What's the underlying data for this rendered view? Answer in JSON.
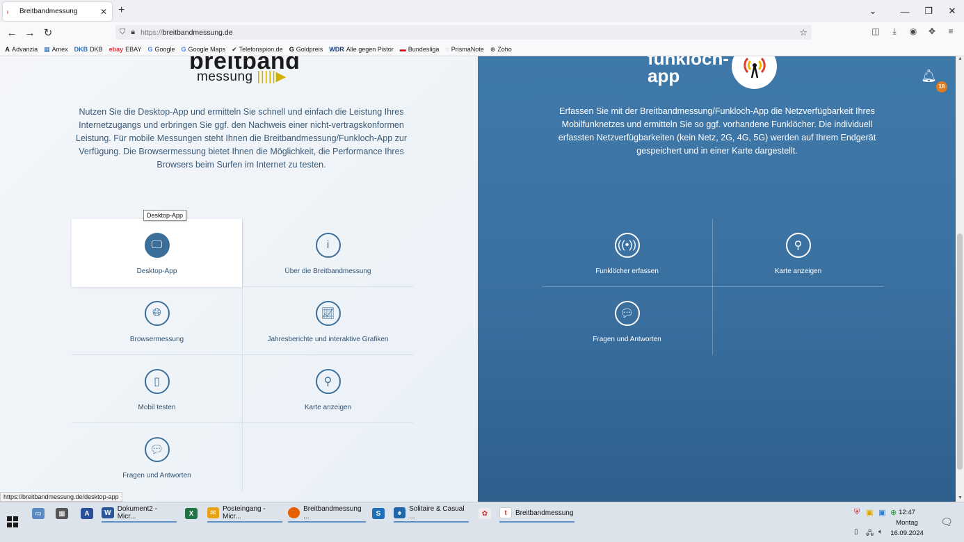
{
  "browser": {
    "tab_title": "Breitbandmessung",
    "url_protocol": "https://",
    "url_host": "breitbandmessung.de",
    "bookmarks": [
      {
        "icon": "Ꭺ",
        "label": "Advanzia",
        "color": "#222"
      },
      {
        "icon": "▦",
        "label": "Amex",
        "color": "#2a6db5"
      },
      {
        "icon": "DKB",
        "label": "DKB",
        "color": "#2a6db5"
      },
      {
        "icon": "ebay",
        "label": "EBAY",
        "color": "#e53238"
      },
      {
        "icon": "G",
        "label": "Google",
        "color": "#4285f4"
      },
      {
        "icon": "G",
        "label": "Google Maps",
        "color": "#4285f4"
      },
      {
        "icon": "✔",
        "label": "Telefonspion.de",
        "color": "#333"
      },
      {
        "icon": "G",
        "label": "Goldpreis",
        "color": "#111"
      },
      {
        "icon": "WDR",
        "label": "Alle gegen Pistor",
        "color": "#1a3c78"
      },
      {
        "icon": "▬",
        "label": "Bundesliga",
        "color": "#d20515"
      },
      {
        "icon": "◌",
        "label": "PrismaNote",
        "color": "#3a9"
      },
      {
        "icon": "⊕",
        "label": "Zoho",
        "color": "#555"
      }
    ],
    "status_url": "https://breitbandmessung.de/desktop-app"
  },
  "left": {
    "logo_line1": "breitband",
    "logo_line2": "messung",
    "description": "Nutzen Sie die Desktop-App und ermitteln Sie schnell und einfach die Leistung Ihres Internetzugangs und erbringen Sie ggf. den Nachweis einer nicht-vertragskonformen Leistung. Für mobile Messungen steht Ihnen die Breitbandmessung/Funkloch-App zur Verfügung. Die Browsermessung bietet Ihnen die Möglichkeit, die Performance Ihres Browsers beim Surfen im Internet zu testen.",
    "items": [
      {
        "label": "Desktop-App",
        "icon": "monitor-icon"
      },
      {
        "label": "Über die Breitbandmessung",
        "icon": "info-icon"
      },
      {
        "label": "Browsermessung",
        "icon": "globe-icon"
      },
      {
        "label": "Jahresberichte und interaktive Grafiken",
        "icon": "chart-icon"
      },
      {
        "label": "Mobil testen",
        "icon": "mobile-icon"
      },
      {
        "label": "Karte anzeigen",
        "icon": "map-pin-icon"
      },
      {
        "label": "Fragen und Antworten",
        "icon": "chat-icon"
      }
    ],
    "tooltip": "Desktop-App"
  },
  "right": {
    "logo_line1": "funkloch-",
    "logo_line2": "app",
    "description": "Erfassen Sie mit der Breitbandmessung/Funkloch-App die Netzverfügbarkeit Ihres Mobilfunknetzes und ermitteln Sie so ggf. vorhandene Funklöcher. Die individuell erfassten Netzverfügbarkeiten (kein Netz, 2G, 4G, 5G) werden auf Ihrem Endgerät gespeichert und in einer Karte dargestellt.",
    "items": [
      {
        "label": "Funklöcher erfassen",
        "icon": "antenna-icon"
      },
      {
        "label": "Karte anzeigen",
        "icon": "map-pin-icon"
      },
      {
        "label": "Fragen und Antworten",
        "icon": "chat-icon"
      }
    ],
    "notification_count": "18"
  },
  "taskbar": {
    "items": [
      {
        "label": "Dokument2 - Micr...",
        "color": "#2b579a",
        "icon": "W"
      },
      {
        "label": "Posteingang - Micr...",
        "color": "#e8a317",
        "icon": "✉"
      },
      {
        "label": "Breitbandmessung ...",
        "color": "#e66000",
        "icon": "●"
      },
      {
        "label": "Solitaire & Casual ...",
        "color": "#2266aa",
        "icon": "♠"
      },
      {
        "label": "Breitbandmessung",
        "color": "#fff",
        "icon": "t"
      }
    ],
    "time": "12:47",
    "day": "Montag",
    "date": "16.09.2024"
  }
}
